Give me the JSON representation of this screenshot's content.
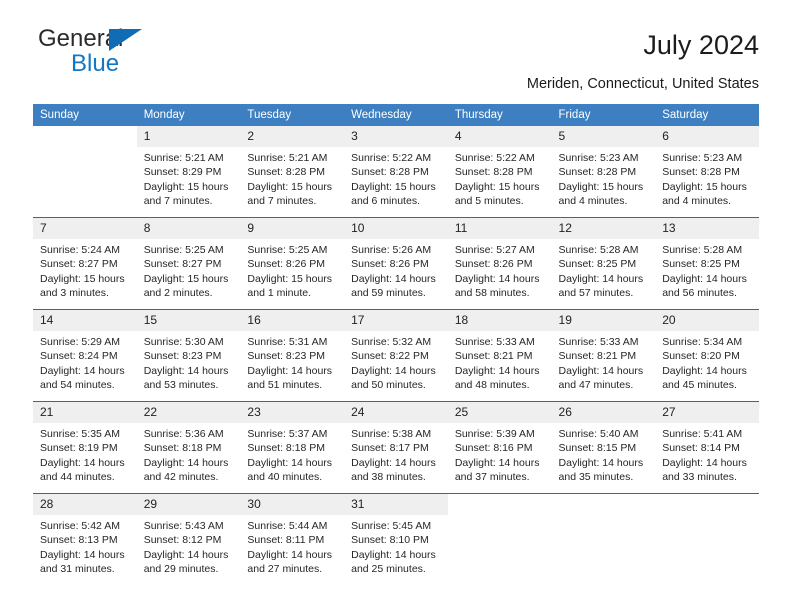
{
  "branding": {
    "name_top": "General",
    "name_bottom": "Blue",
    "triangle_color": "#0f6cb5",
    "blue_text_color": "#1477c4"
  },
  "header": {
    "title": "July 2024",
    "subtitle": "Meriden, Connecticut, United States"
  },
  "theme": {
    "header_bg": "#3d7fc1",
    "week_divider": "#2a6ba8",
    "daynum_bg": "#efefef",
    "text": "#262626"
  },
  "weekday_headers": [
    "Sunday",
    "Monday",
    "Tuesday",
    "Wednesday",
    "Thursday",
    "Friday",
    "Saturday"
  ],
  "labels": {
    "sunrise_prefix": "Sunrise:",
    "sunset_prefix": "Sunset:",
    "daylight_prefix": "Daylight:"
  },
  "weeks": [
    [
      {
        "day": "",
        "l1": "",
        "l2": "",
        "l3": "",
        "l4": ""
      },
      {
        "day": "1",
        "l1": "Sunrise: 5:21 AM",
        "l2": "Sunset: 8:29 PM",
        "l3": "Daylight: 15 hours",
        "l4": "and 7 minutes."
      },
      {
        "day": "2",
        "l1": "Sunrise: 5:21 AM",
        "l2": "Sunset: 8:28 PM",
        "l3": "Daylight: 15 hours",
        "l4": "and 7 minutes."
      },
      {
        "day": "3",
        "l1": "Sunrise: 5:22 AM",
        "l2": "Sunset: 8:28 PM",
        "l3": "Daylight: 15 hours",
        "l4": "and 6 minutes."
      },
      {
        "day": "4",
        "l1": "Sunrise: 5:22 AM",
        "l2": "Sunset: 8:28 PM",
        "l3": "Daylight: 15 hours",
        "l4": "and 5 minutes."
      },
      {
        "day": "5",
        "l1": "Sunrise: 5:23 AM",
        "l2": "Sunset: 8:28 PM",
        "l3": "Daylight: 15 hours",
        "l4": "and 4 minutes."
      },
      {
        "day": "6",
        "l1": "Sunrise: 5:23 AM",
        "l2": "Sunset: 8:28 PM",
        "l3": "Daylight: 15 hours",
        "l4": "and 4 minutes."
      }
    ],
    [
      {
        "day": "7",
        "l1": "Sunrise: 5:24 AM",
        "l2": "Sunset: 8:27 PM",
        "l3": "Daylight: 15 hours",
        "l4": "and 3 minutes."
      },
      {
        "day": "8",
        "l1": "Sunrise: 5:25 AM",
        "l2": "Sunset: 8:27 PM",
        "l3": "Daylight: 15 hours",
        "l4": "and 2 minutes."
      },
      {
        "day": "9",
        "l1": "Sunrise: 5:25 AM",
        "l2": "Sunset: 8:26 PM",
        "l3": "Daylight: 15 hours",
        "l4": "and 1 minute."
      },
      {
        "day": "10",
        "l1": "Sunrise: 5:26 AM",
        "l2": "Sunset: 8:26 PM",
        "l3": "Daylight: 14 hours",
        "l4": "and 59 minutes."
      },
      {
        "day": "11",
        "l1": "Sunrise: 5:27 AM",
        "l2": "Sunset: 8:26 PM",
        "l3": "Daylight: 14 hours",
        "l4": "and 58 minutes."
      },
      {
        "day": "12",
        "l1": "Sunrise: 5:28 AM",
        "l2": "Sunset: 8:25 PM",
        "l3": "Daylight: 14 hours",
        "l4": "and 57 minutes."
      },
      {
        "day": "13",
        "l1": "Sunrise: 5:28 AM",
        "l2": "Sunset: 8:25 PM",
        "l3": "Daylight: 14 hours",
        "l4": "and 56 minutes."
      }
    ],
    [
      {
        "day": "14",
        "l1": "Sunrise: 5:29 AM",
        "l2": "Sunset: 8:24 PM",
        "l3": "Daylight: 14 hours",
        "l4": "and 54 minutes."
      },
      {
        "day": "15",
        "l1": "Sunrise: 5:30 AM",
        "l2": "Sunset: 8:23 PM",
        "l3": "Daylight: 14 hours",
        "l4": "and 53 minutes."
      },
      {
        "day": "16",
        "l1": "Sunrise: 5:31 AM",
        "l2": "Sunset: 8:23 PM",
        "l3": "Daylight: 14 hours",
        "l4": "and 51 minutes."
      },
      {
        "day": "17",
        "l1": "Sunrise: 5:32 AM",
        "l2": "Sunset: 8:22 PM",
        "l3": "Daylight: 14 hours",
        "l4": "and 50 minutes."
      },
      {
        "day": "18",
        "l1": "Sunrise: 5:33 AM",
        "l2": "Sunset: 8:21 PM",
        "l3": "Daylight: 14 hours",
        "l4": "and 48 minutes."
      },
      {
        "day": "19",
        "l1": "Sunrise: 5:33 AM",
        "l2": "Sunset: 8:21 PM",
        "l3": "Daylight: 14 hours",
        "l4": "and 47 minutes."
      },
      {
        "day": "20",
        "l1": "Sunrise: 5:34 AM",
        "l2": "Sunset: 8:20 PM",
        "l3": "Daylight: 14 hours",
        "l4": "and 45 minutes."
      }
    ],
    [
      {
        "day": "21",
        "l1": "Sunrise: 5:35 AM",
        "l2": "Sunset: 8:19 PM",
        "l3": "Daylight: 14 hours",
        "l4": "and 44 minutes."
      },
      {
        "day": "22",
        "l1": "Sunrise: 5:36 AM",
        "l2": "Sunset: 8:18 PM",
        "l3": "Daylight: 14 hours",
        "l4": "and 42 minutes."
      },
      {
        "day": "23",
        "l1": "Sunrise: 5:37 AM",
        "l2": "Sunset: 8:18 PM",
        "l3": "Daylight: 14 hours",
        "l4": "and 40 minutes."
      },
      {
        "day": "24",
        "l1": "Sunrise: 5:38 AM",
        "l2": "Sunset: 8:17 PM",
        "l3": "Daylight: 14 hours",
        "l4": "and 38 minutes."
      },
      {
        "day": "25",
        "l1": "Sunrise: 5:39 AM",
        "l2": "Sunset: 8:16 PM",
        "l3": "Daylight: 14 hours",
        "l4": "and 37 minutes."
      },
      {
        "day": "26",
        "l1": "Sunrise: 5:40 AM",
        "l2": "Sunset: 8:15 PM",
        "l3": "Daylight: 14 hours",
        "l4": "and 35 minutes."
      },
      {
        "day": "27",
        "l1": "Sunrise: 5:41 AM",
        "l2": "Sunset: 8:14 PM",
        "l3": "Daylight: 14 hours",
        "l4": "and 33 minutes."
      }
    ],
    [
      {
        "day": "28",
        "l1": "Sunrise: 5:42 AM",
        "l2": "Sunset: 8:13 PM",
        "l3": "Daylight: 14 hours",
        "l4": "and 31 minutes."
      },
      {
        "day": "29",
        "l1": "Sunrise: 5:43 AM",
        "l2": "Sunset: 8:12 PM",
        "l3": "Daylight: 14 hours",
        "l4": "and 29 minutes."
      },
      {
        "day": "30",
        "l1": "Sunrise: 5:44 AM",
        "l2": "Sunset: 8:11 PM",
        "l3": "Daylight: 14 hours",
        "l4": "and 27 minutes."
      },
      {
        "day": "31",
        "l1": "Sunrise: 5:45 AM",
        "l2": "Sunset: 8:10 PM",
        "l3": "Daylight: 14 hours",
        "l4": "and 25 minutes."
      },
      {
        "day": "",
        "l1": "",
        "l2": "",
        "l3": "",
        "l4": ""
      },
      {
        "day": "",
        "l1": "",
        "l2": "",
        "l3": "",
        "l4": ""
      },
      {
        "day": "",
        "l1": "",
        "l2": "",
        "l3": "",
        "l4": ""
      }
    ]
  ]
}
